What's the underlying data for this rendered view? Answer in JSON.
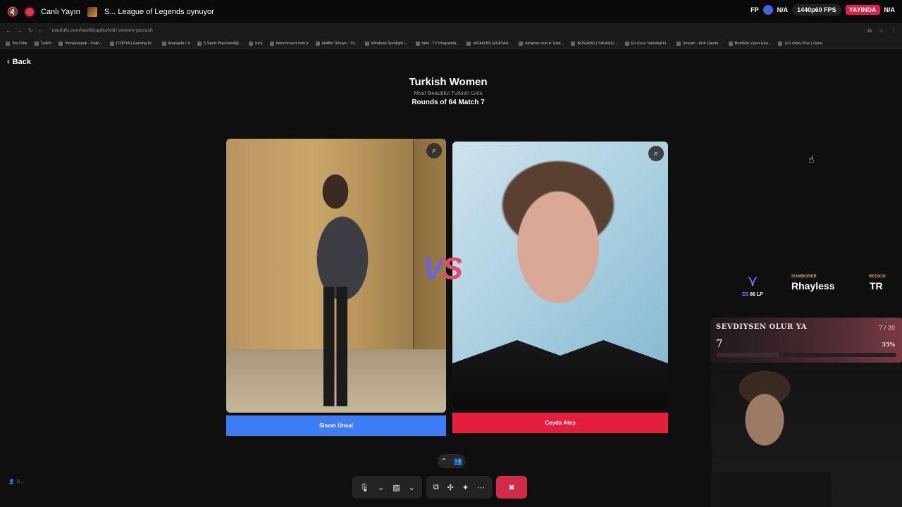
{
  "stream": {
    "live_label": "Canlı Yayın",
    "title": "S... League of Legends oynuyor",
    "right": {
      "fps_prefix": "FP",
      "na1": "N/A",
      "fps": "1440p60 FPS",
      "live_badge": "YAYINDA",
      "na2": "N/A"
    }
  },
  "browser": {
    "url": "uwufufu.com/worldcup/turkish-women-jaccush",
    "bookmarks": [
      "YouTube",
      "Twitch",
      "Yemeksepeti - Onlin...",
      "ITOPYA | Gaming Ür...",
      "Anasayfa / X",
      "S Sport Plus-İstediği...",
      "Kick",
      "beinconnect.com.tr",
      "Netflix Türkiye - TV...",
      "Windows Spotlight I...",
      "tabii - TV Programla...",
      "VATAN BİLGİSAYAR...",
      "Amazon.com.tr: Elek...",
      "BUSHIDO | SAVAŞÇI...",
      "En Ucuz Teknoloji Fi...",
      "Stream - Kick Dashb...",
      "Bushido Vyper Eau...",
      "101 Okey Plus | Oyna"
    ]
  },
  "page": {
    "back_label": "Back",
    "title": "Turkish Women",
    "subtitle": "Most Beautiful Turkish Girls",
    "round": "Rounds of 64 Match 7",
    "vs": "VS",
    "left_name": "Sinem Ünsal",
    "right_name": "Ceyda Ateş"
  },
  "summoner": {
    "rank": "D3",
    "lp": "86 LP",
    "label": "SUMMONER",
    "name": "Rhayless",
    "region_label": "REGION",
    "region": "TR"
  },
  "goal": {
    "title": "SEVDIYSEN OLUR YA",
    "count": "7 / 20",
    "current": "7",
    "percent": "35%",
    "progress": 0.35
  },
  "bottom_left": "S...",
  "colors": {
    "left_btn": "#3d7df6",
    "right_btn": "#e51e3d",
    "hangup": "#d42a4a"
  }
}
